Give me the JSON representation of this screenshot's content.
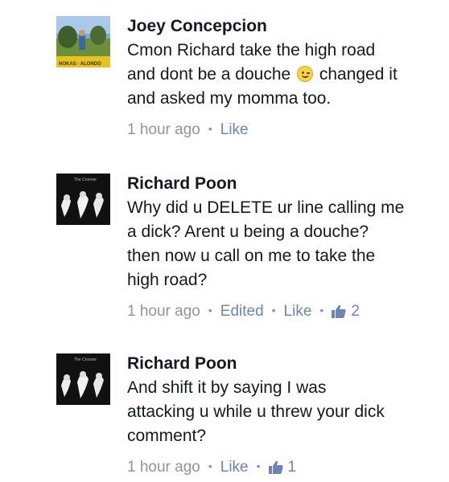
{
  "comments": [
    {
      "author": "Joey Concepcion",
      "lines": [
        "Cmon Richard take the high road",
        "and dont be a douche",
        "changed it",
        "and asked my momma too."
      ],
      "emoji": "wink-smile-icon",
      "time": "1 hour ago",
      "like_label": "Like"
    },
    {
      "author": "Richard Poon",
      "lines": [
        "Why did u DELETE ur line calling me",
        "a dick? Arent u being a douche?",
        "then now u call on me to take the",
        "high road?"
      ],
      "time": "1 hour ago",
      "edited_label": "Edited",
      "like_label": "Like",
      "like_count": "2"
    },
    {
      "author": "Richard Poon",
      "lines": [
        "And shift it by saying I was",
        "attacking u while u threw your dick",
        "comment?"
      ],
      "time": "1 hour ago",
      "like_label": "Like",
      "like_count": "1"
    }
  ],
  "colors": {
    "text": "#141823",
    "meta": "#90949c",
    "link": "#6d84b4"
  }
}
